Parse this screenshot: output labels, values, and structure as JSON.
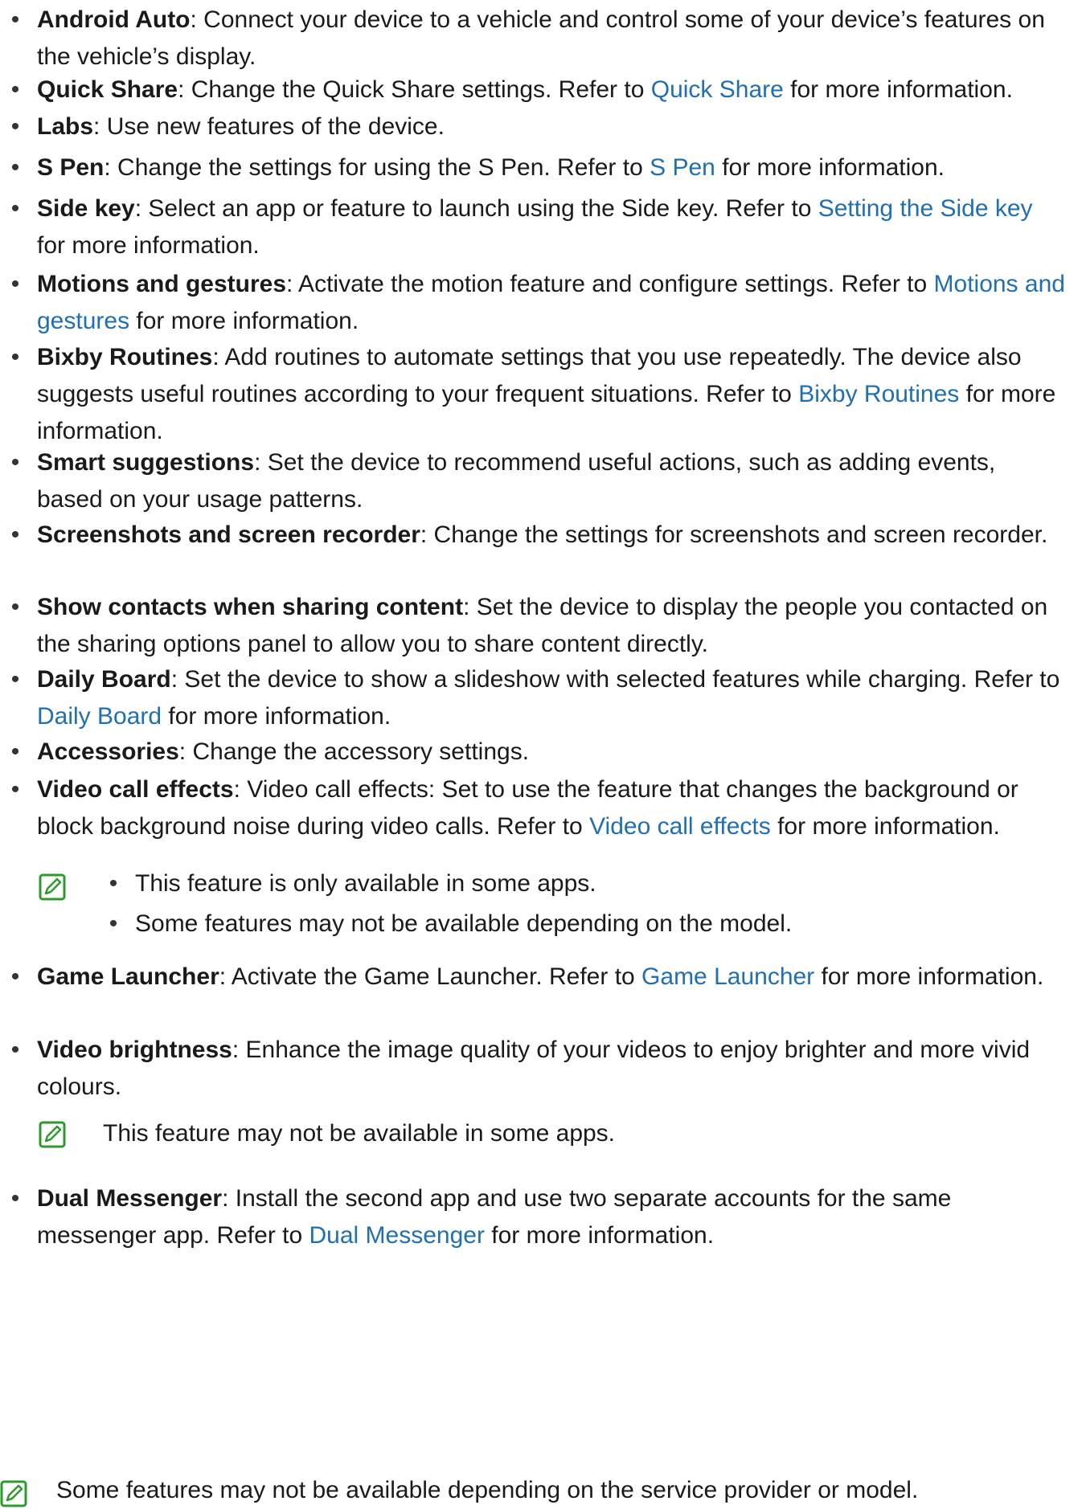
{
  "items": [
    {
      "key": "android_auto",
      "title": "Android Auto",
      "parts": [
        ": Connect your device to a vehicle and control some of your device’s features on the vehicle’s display."
      ]
    },
    {
      "key": "quick_share",
      "title": "Quick Share",
      "parts": [
        ": Change the Quick Share settings. Refer to ",
        "Quick Share",
        " for more information."
      ]
    },
    {
      "key": "labs",
      "title": "Labs",
      "parts": [
        ": Use new features of the device."
      ]
    },
    {
      "key": "s_pen",
      "title": "S Pen",
      "parts": [
        ": Change the settings for using the S Pen. Refer to ",
        "S Pen",
        " for more information."
      ]
    },
    {
      "key": "side_key",
      "title": "Side key",
      "parts": [
        ": Select an app or feature to launch using the Side key. Refer to ",
        "Setting the Side key",
        " for more information."
      ]
    },
    {
      "key": "motions",
      "title": "Motions and gestures",
      "parts": [
        ": Activate the motion feature and configure settings. Refer to ",
        "Motions and gestures",
        " for more information."
      ]
    },
    {
      "key": "bixby",
      "title": "Bixby Routines",
      "parts": [
        ": Add routines to automate settings that you use repeatedly. The device also suggests useful routines according to your frequent situations. Refer to ",
        "Bixby Routines",
        " for more information."
      ]
    },
    {
      "key": "smart",
      "title": "Smart suggestions",
      "parts": [
        ": Set the device to recommend useful actions, such as adding events, based on your usage patterns."
      ]
    },
    {
      "key": "screenshots",
      "title": "Screenshots and screen recorder",
      "parts": [
        ": Change the settings for screenshots and screen recorder."
      ]
    },
    {
      "key": "contacts",
      "title": "Show contacts when sharing content",
      "parts": [
        ": Set the device to display the people you contacted on the sharing options panel to allow you to share content directly."
      ]
    },
    {
      "key": "daily",
      "title": "Daily Board",
      "parts": [
        ": Set the device to show a slideshow with selected features while charging. Refer to ",
        "Daily Board",
        " for more information."
      ]
    },
    {
      "key": "accessories",
      "title": "Accessories",
      "parts": [
        ": Change the accessory settings."
      ]
    },
    {
      "key": "video_call",
      "title": "Video call effects",
      "parts": [
        ": Video call effects: Set to use the feature that changes the background or block background noise during video calls. Refer to ",
        "Video call effects",
        " for more information."
      ]
    },
    {
      "key": "game",
      "title": "Game Launcher",
      "parts": [
        ": Activate the Game Launcher. Refer to ",
        "Game Launcher",
        " for more information."
      ]
    },
    {
      "key": "video_brightness",
      "title": "Video brightness",
      "parts": [
        ": Enhance the image quality of your videos to enjoy brighter and more vivid colours."
      ]
    },
    {
      "key": "dual",
      "title": "Dual Messenger",
      "parts": [
        ": Install the second app and use two separate accounts for the same messenger app. Refer to ",
        "Dual Messenger",
        " for more information."
      ]
    }
  ],
  "notes": {
    "video_call_1": "This feature is only available in some apps.",
    "video_call_2": "Some features may not be available depending on the model.",
    "video_brightness": "This feature may not be available in some apps.",
    "footer": "Some features may not be available depending on the service provider or model."
  },
  "bullet_char": "•",
  "colors": {
    "link": "#1f6fb5",
    "note_icon": "#2e9a2e"
  }
}
